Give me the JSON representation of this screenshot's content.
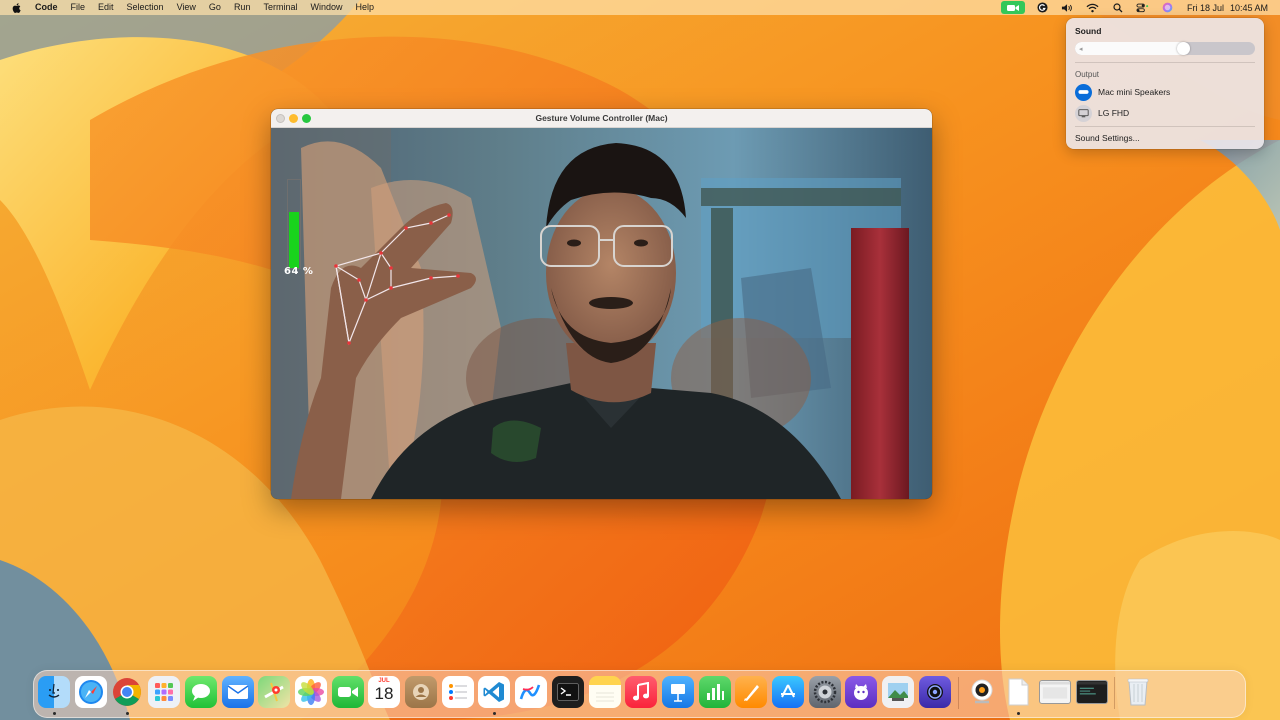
{
  "menubar": {
    "app_name": "Code",
    "menus": [
      "File",
      "Edit",
      "Selection",
      "View",
      "Go",
      "Run",
      "Terminal",
      "Window",
      "Help"
    ],
    "date": "Fri 18 Jul",
    "time": "10:45 AM",
    "status_icons": [
      "facetime-camera-icon",
      "grammarly-icon",
      "volume-icon",
      "wifi-icon",
      "search-icon",
      "control-center-icon",
      "siri-icon"
    ]
  },
  "sound_panel": {
    "title": "Sound",
    "volume_fraction": 0.64,
    "output_label": "Output",
    "devices": [
      {
        "name": "Mac mini Speakers",
        "active": true
      },
      {
        "name": "LG FHD",
        "active": false
      }
    ],
    "settings_label": "Sound Settings..."
  },
  "app_window": {
    "title": "Gesture Volume Controller (Mac)",
    "volume_percent": 64,
    "volume_text": "64  %",
    "bar_color": "#19d31c"
  },
  "dock": {
    "apps": [
      {
        "name": "Finder",
        "icon": "finder-icon",
        "running": true
      },
      {
        "name": "Safari",
        "icon": "safari-icon",
        "running": false
      },
      {
        "name": "Chrome",
        "icon": "chrome-icon",
        "running": true
      },
      {
        "name": "Launchpad",
        "icon": "launchpad-icon",
        "running": false
      },
      {
        "name": "Messages",
        "icon": "messages-icon",
        "running": false
      },
      {
        "name": "Mail",
        "icon": "mail-icon",
        "running": false
      },
      {
        "name": "Maps",
        "icon": "maps-icon",
        "running": false
      },
      {
        "name": "Photos",
        "icon": "photos-icon",
        "running": false
      },
      {
        "name": "FaceTime",
        "icon": "facetime-icon",
        "running": false
      },
      {
        "name": "Calendar",
        "icon": "calendar-icon",
        "running": false,
        "month": "JUL",
        "day": "18"
      },
      {
        "name": "Contacts",
        "icon": "contacts-icon",
        "running": false
      },
      {
        "name": "Reminders",
        "icon": "reminders-icon",
        "running": false
      },
      {
        "name": "VS Code",
        "icon": "vscode-icon",
        "running": true
      },
      {
        "name": "Freeform",
        "icon": "freeform-icon",
        "running": false
      },
      {
        "name": "Terminal",
        "icon": "terminal-icon",
        "running": false
      },
      {
        "name": "Notes",
        "icon": "notes-icon",
        "running": false
      },
      {
        "name": "Music",
        "icon": "music-icon",
        "running": false
      },
      {
        "name": "Keynote",
        "icon": "keynote-icon",
        "running": false
      },
      {
        "name": "Numbers",
        "icon": "numbers-icon",
        "running": false
      },
      {
        "name": "Pages",
        "icon": "pages-icon",
        "running": false
      },
      {
        "name": "App Store",
        "icon": "app-store-icon",
        "running": false
      },
      {
        "name": "System Settings",
        "icon": "system-settings-icon",
        "running": false
      },
      {
        "name": "Fig",
        "icon": "fig-icon",
        "running": false
      },
      {
        "name": "Preview",
        "icon": "preview-icon",
        "running": false
      },
      {
        "name": "Screen Recorder",
        "icon": "screen-recorder-icon",
        "running": false
      },
      {
        "name": "Webcam",
        "icon": "webcam-icon",
        "running": false
      },
      {
        "name": "Document",
        "icon": "document-icon",
        "running": true
      },
      {
        "name": "Chrome Window",
        "icon": "window-thumbnail-icon",
        "running": false
      },
      {
        "name": "VS Code Window",
        "icon": "window-thumbnail-icon",
        "running": false
      },
      {
        "name": "Trash",
        "icon": "trash-icon",
        "running": false
      }
    ]
  }
}
